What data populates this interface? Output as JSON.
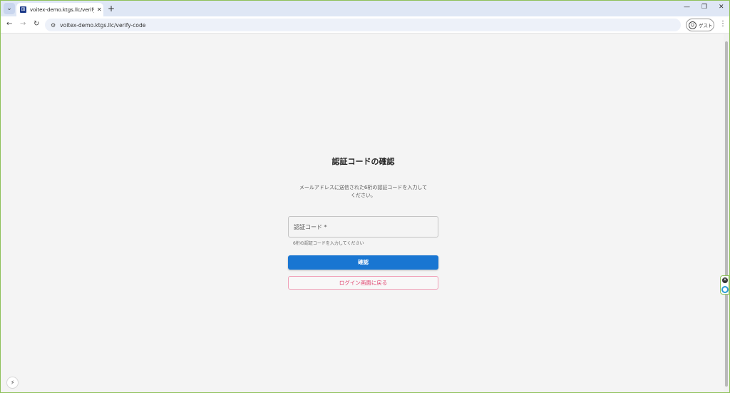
{
  "browser": {
    "tab": {
      "title": "voitex-demo.ktgs.llc/verify-code",
      "favicon_glyph": "⊞",
      "close_glyph": "✕"
    },
    "tab_list_glyph": "⌄",
    "new_tab_glyph": "+",
    "window_controls": {
      "minimize": "—",
      "restore": "❐",
      "close": "✕"
    },
    "nav": {
      "back": "←",
      "forward": "→",
      "reload": "↻"
    },
    "site_info_glyph": "⚙",
    "url": "voitex-demo.ktgs.llc/verify-code",
    "profile": {
      "icon_glyph": "☺",
      "label": "ゲスト"
    },
    "menu_glyph": "⋮"
  },
  "page": {
    "title": "認証コードの確認",
    "description_line1": "メールアドレスに送信された6桁の認証コードを入力して",
    "description_line2": "ください。",
    "code_field": {
      "label": "認証コード *",
      "helper": "6桁の認証コードを入力してください"
    },
    "confirm_button": "確認",
    "back_button": "ログイン画面に戻る"
  },
  "overlay": {
    "ext_close_glyph": "✕",
    "corner_glyph": "⚡"
  },
  "colors": {
    "primary": "#1976d2",
    "back_text": "#e0456f",
    "back_border": "#f0a0b8",
    "window_border": "#8ec15a"
  }
}
